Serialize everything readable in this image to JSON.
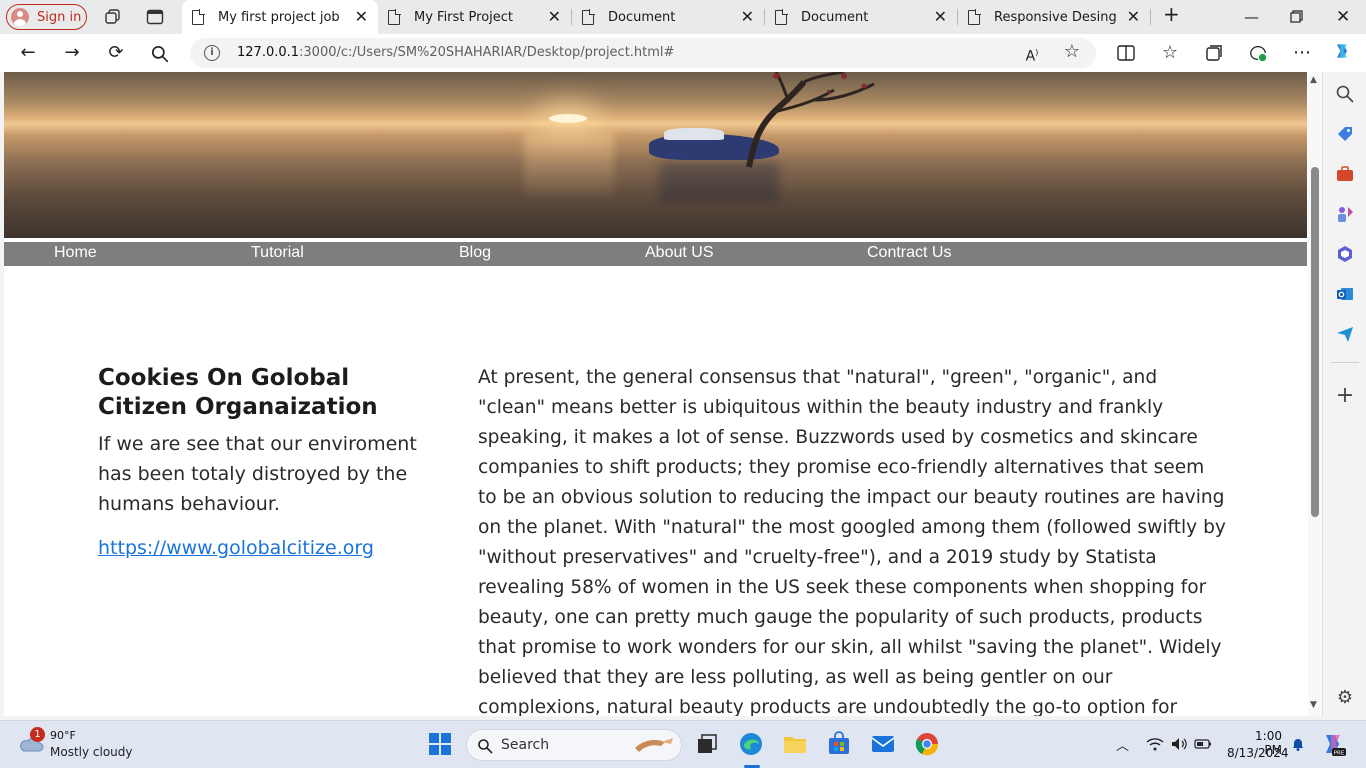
{
  "browser": {
    "signin_label": "Sign in",
    "tabs": [
      {
        "title": "My first project job",
        "active": true
      },
      {
        "title": "My First Project",
        "active": false
      },
      {
        "title": "Document",
        "active": false
      },
      {
        "title": "Document",
        "active": false
      },
      {
        "title": "Responsive Desing",
        "active": false
      }
    ],
    "url_host": "127.0.0.1",
    "url_rest": ":3000/c:/Users/SM%20SHAHARIAR/Desktop/project.html#"
  },
  "page": {
    "nav": [
      "Home",
      "Tutorial",
      "Blog",
      "About US",
      "Contract Us"
    ],
    "aside": {
      "title": "Cookies On Golobal Citizen Organaization",
      "text": "If we are see that our enviroment has been totaly distroyed by the humans behaviour.",
      "link": "https://www.golobalcitize.org"
    },
    "article": "At present, the general consensus that \"natural\", \"green\", \"organic\", and \"clean\" means better is ubiquitous within the beauty industry and frankly speaking, it makes a lot of sense. Buzzwords used by cosmetics and skincare companies to shift products; they promise eco-friendly alternatives that seem to be an obvious solution to reducing the impact our beauty routines are having on the planet. With \"natural\" the most googled among them (followed swiftly by \"without preservatives\" and \"cruelty-free\"), and a 2019 study by Statista revealing 58% of women in the US seek these components when shopping for beauty, one can pretty much gauge the popularity of such products, products that promise to work wonders for our skin, all whilst \"saving the planet\". Widely believed that they are less polluting, as well as being gentler on our complexions, natural beauty products are undoubtedly the go-to option for conscious consumers more aware than ever"
  },
  "taskbar": {
    "weather_temp": "90°F",
    "weather_desc": "Mostly cloudy",
    "notification_count": "1",
    "search_label": "Search",
    "time": "1:00 PM",
    "date": "8/13/2024"
  },
  "colors": {
    "menu_bg": "#7e7e7e",
    "link": "#1a73d9",
    "signin": "#c42b1c"
  }
}
